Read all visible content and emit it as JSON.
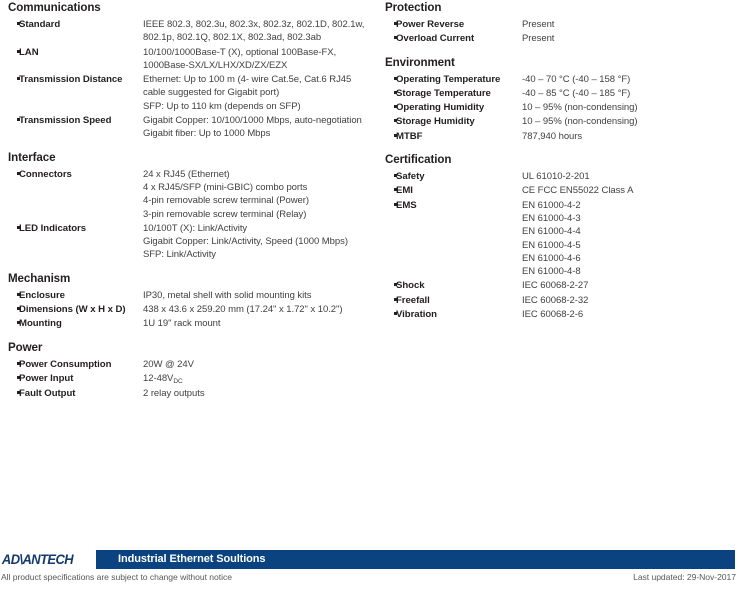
{
  "document": {
    "type": "product-specification-datasheet"
  },
  "colors": {
    "brand_blue": "#0a4380",
    "logo_navy": "#143a6b",
    "label_text": "#231f20",
    "value_text": "#414042",
    "footer_text": "#58595b"
  },
  "left_column": {
    "sections": [
      {
        "title": "Communications",
        "rows": [
          {
            "label": "Standard",
            "lines": [
              "IEEE 802.3, 802.3u, 802.3x, 802.3z, 802.1D, 802.1w,",
              "802.1p, 802.1Q, 802.1X, 802.3ad, 802.3ab"
            ]
          },
          {
            "label": "LAN",
            "lines": [
              "10/100/1000Base-T (X), optional 100Base-FX,",
              "1000Base-SX/LX/LHX/XD/ZX/EZX"
            ]
          },
          {
            "label": "Transmission Distance",
            "lines": [
              "Ethernet: Up to 100 m (4- wire Cat.5e, Cat.6 RJ45",
              "cable suggested for Gigabit port)",
              "SFP: Up to 110 km (depends on SFP)"
            ]
          },
          {
            "label": "Transmission Speed",
            "lines": [
              "Gigabit Copper: 10/100/1000 Mbps, auto-negotiation",
              "Gigabit fiber: Up to 1000 Mbps"
            ]
          }
        ]
      },
      {
        "title": "Interface",
        "rows": [
          {
            "label": "Connectors",
            "lines": [
              "24 x RJ45 (Ethernet)",
              "4 x RJ45/SFP (mini-GBIC) combo ports",
              "4-pin removable screw terminal (Power)",
              "3-pin removable screw terminal (Relay)"
            ]
          },
          {
            "label": "LED Indicators",
            "lines": [
              "10/100T (X): Link/Activity",
              "Gigabit Copper: Link/Activity, Speed (1000 Mbps)",
              "SFP: Link/Activity"
            ]
          }
        ]
      },
      {
        "title": "Mechanism",
        "rows": [
          {
            "label": "Enclosure",
            "lines": [
              "IP30, metal shell with solid mounting kits"
            ]
          },
          {
            "label": "Dimensions (W x H x D)",
            "lines": [
              "438 x 43.6 x 259.20 mm (17.24\" x 1.72\" x 10.2\")"
            ]
          },
          {
            "label": "Mounting",
            "lines": [
              "1U 19\" rack mount"
            ]
          }
        ]
      },
      {
        "title": "Power",
        "rows": [
          {
            "label": "Power Consumption",
            "lines": [
              "20W @ 24V"
            ]
          },
          {
            "label": "Power Input",
            "lines": [
              "12-48V"
            ],
            "subscript": "DC"
          },
          {
            "label": "Fault Output",
            "lines": [
              "2 relay outputs"
            ]
          }
        ]
      }
    ]
  },
  "right_column": {
    "sections": [
      {
        "title": "Protection",
        "rows": [
          {
            "label": "Power Reverse",
            "lines": [
              "Present"
            ]
          },
          {
            "label": "Overload Current",
            "lines": [
              "Present"
            ]
          }
        ]
      },
      {
        "title": "Environment",
        "rows": [
          {
            "label": "Operating Temperature",
            "lines": [
              "-40 – 70 °C (-40 – 158 °F)"
            ]
          },
          {
            "label": "Storage Temperature",
            "lines": [
              "-40 – 85 °C (-40 – 185 °F)"
            ]
          },
          {
            "label": "Operating Humidity",
            "lines": [
              "10 – 95% (non-condensing)"
            ]
          },
          {
            "label": "Storage Humidity",
            "lines": [
              "10 – 95% (non-condensing)"
            ]
          },
          {
            "label": "MTBF",
            "lines": [
              "787,940 hours"
            ]
          }
        ]
      },
      {
        "title": "Certification",
        "rows": [
          {
            "label": "Safety",
            "lines": [
              "UL 61010-2-201"
            ]
          },
          {
            "label": "EMI",
            "lines": [
              "CE FCC EN55022 Class A"
            ]
          },
          {
            "label": "EMS",
            "lines": [
              "EN 61000-4-2",
              "EN 61000-4-3",
              "EN 61000-4-4",
              "EN 61000-4-5",
              "EN 61000-4-6",
              "EN 61000-4-8"
            ]
          },
          {
            "label": "Shock",
            "lines": [
              "IEC 60068-2-27"
            ]
          },
          {
            "label": "Freefall",
            "lines": [
              "IEC 60068-2-32"
            ]
          },
          {
            "label": "Vibration",
            "lines": [
              "IEC 60068-2-6"
            ]
          }
        ]
      }
    ]
  },
  "footer": {
    "logo_text": "AD\\ANTECH",
    "bar_title": "Industrial Ethernet Soultions",
    "note": "All product specifications are subject to change without notice",
    "updated": "Last updated: 29-Nov-2017"
  }
}
